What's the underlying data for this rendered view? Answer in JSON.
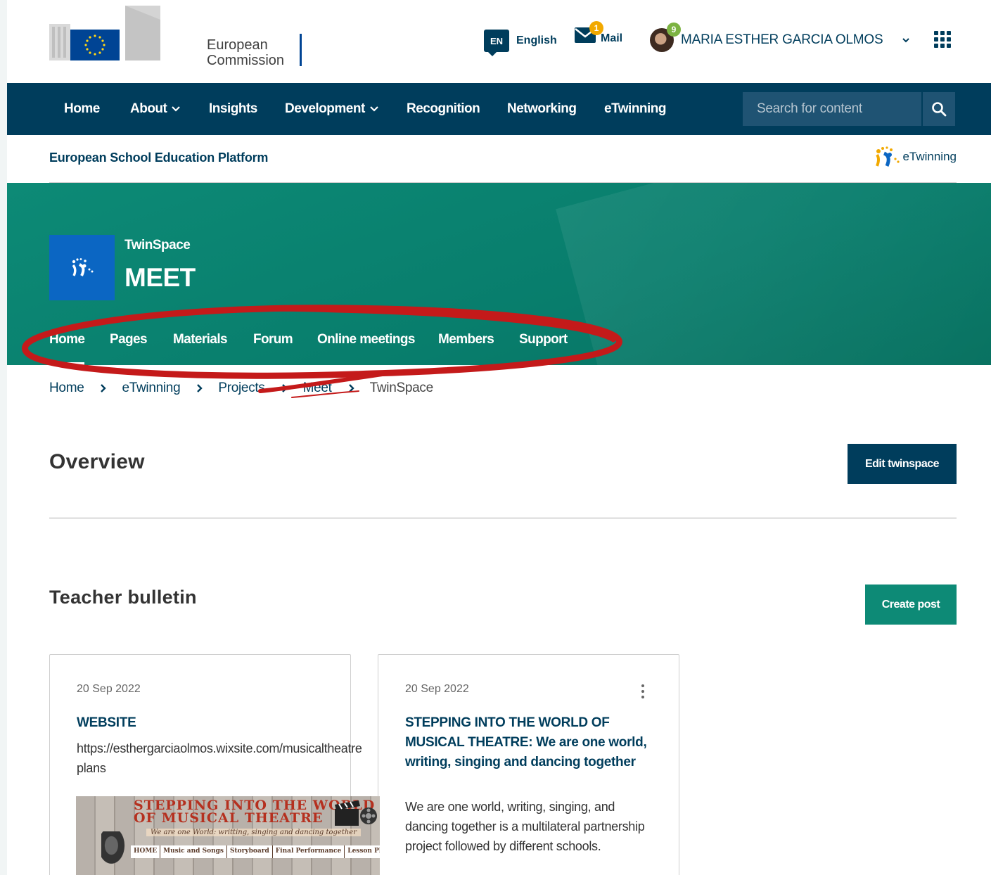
{
  "header": {
    "brand_line1": "European",
    "brand_line2": "Commission",
    "language_code": "EN",
    "language_label": "English",
    "mail_count": "1",
    "mail_label": "Mail",
    "user_badge": "9",
    "user_name": "MARIA ESTHER GARCIA OLMOS"
  },
  "nav": {
    "items": [
      "Home",
      "About",
      "Insights",
      "Development",
      "Recognition",
      "Networking",
      "eTwinning"
    ],
    "search_placeholder": "Search for content"
  },
  "site": {
    "title": "European School Education Platform",
    "etwinning_logo": "eTwinning"
  },
  "twinspace": {
    "label": "TwinSpace",
    "name": "MEET",
    "tabs": [
      "Home",
      "Pages",
      "Materials",
      "Forum",
      "Online meetings",
      "Members",
      "Support"
    ],
    "active_tab": "Home"
  },
  "breadcrumb": [
    "Home",
    "eTwinning",
    "Projects",
    "Meet",
    "TwinSpace"
  ],
  "overview": {
    "title": "Overview",
    "edit_button": "Edit twinspace"
  },
  "bulletin": {
    "title": "Teacher bulletin",
    "create_button": "Create post",
    "posts": [
      {
        "date": "20 Sep 2022",
        "title": "WEBSITE",
        "body_line1": "https://esthergarciaolmos.wixsite.com/musicaltheatre",
        "body_line2": "plans",
        "image": {
          "title_line1": "STEPPING INTO THE WORLD",
          "title_line2": "OF MUSICAL THEATRE",
          "subtitle": "We are one World: writting, singing and dancing together",
          "menu": [
            "HOME",
            "Music and Songs",
            "Storyboard",
            "Final Performance",
            "Lesson Plan"
          ]
        }
      },
      {
        "date": "20 Sep 2022",
        "title": "STEPPING INTO THE WORLD OF MUSICAL THEATRE: We are one world, writing, singing and dancing together",
        "body": "We are one world, writing, singing, and dancing together is a multilateral partnership project followed by different schools."
      }
    ]
  },
  "colors": {
    "navy": "#003d5c",
    "teal": "#0d8a76",
    "annotation_red": "#c41a1a",
    "mail_badge": "#f2a900",
    "user_badge": "#7cb342"
  }
}
